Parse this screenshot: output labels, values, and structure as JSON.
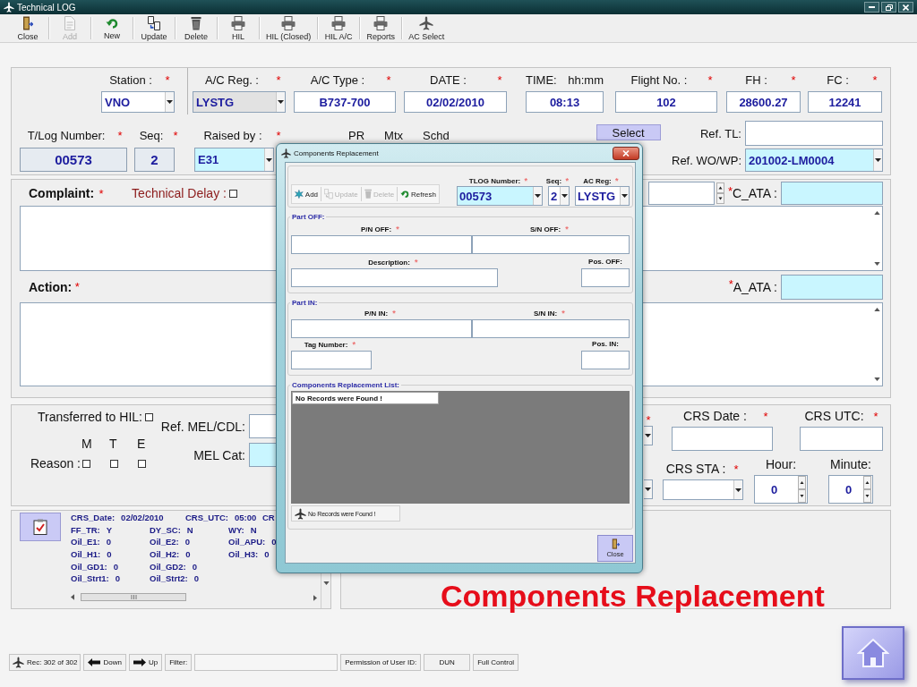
{
  "window": {
    "title": "Technical LOG"
  },
  "toolbar": [
    {
      "label": "Close",
      "kind": "door",
      "disabled": false
    },
    {
      "label": "Add",
      "kind": "add",
      "disabled": true
    },
    {
      "label": "New",
      "kind": "new",
      "disabled": false
    },
    {
      "label": "Update",
      "kind": "update",
      "disabled": false
    },
    {
      "label": "Delete",
      "kind": "delete",
      "disabled": false
    },
    {
      "label": "HIL",
      "kind": "print",
      "disabled": false
    },
    {
      "label": "HIL (Closed)",
      "kind": "print",
      "disabled": false
    },
    {
      "label": "HIL A/C",
      "kind": "print",
      "disabled": false
    },
    {
      "label": "Reports",
      "kind": "print",
      "disabled": false
    },
    {
      "label": "AC Select",
      "kind": "aircraft",
      "disabled": false
    }
  ],
  "flight": [
    {
      "label": "Station :",
      "asterisk": "*",
      "value": "VNO",
      "kind": "combo",
      "readonly": false
    },
    {
      "label": "A/C Reg. :",
      "asterisk": "*",
      "value": "LYSTG",
      "kind": "combo",
      "readonly": true
    },
    {
      "label": "A/C Type :",
      "asterisk": "*",
      "value": "B737-700",
      "kind": "text",
      "readonly": false
    },
    {
      "label": "DATE :",
      "asterisk": "*",
      "value": "02/02/2010",
      "kind": "text",
      "readonly": false
    },
    {
      "label": "TIME:",
      "format": "hh:mm",
      "value": "08:13",
      "kind": "text",
      "readonly": false
    },
    {
      "label": "Flight No. :",
      "asterisk": "*",
      "value": "102",
      "kind": "text",
      "readonly": false
    },
    {
      "label": "FH :",
      "asterisk": "*",
      "value": "28600.27",
      "kind": "text",
      "readonly": false
    },
    {
      "label": "FC :",
      "asterisk": "*",
      "value": "12241",
      "kind": "text",
      "readonly": false
    }
  ],
  "log": {
    "fields": [
      {
        "label": "T/Log Number:",
        "asterisk": "*",
        "value": "00573",
        "kind": "display",
        "highlighted": false
      },
      {
        "label": "Seq:",
        "asterisk": "*",
        "value": "2",
        "kind": "display",
        "highlighted": false
      },
      {
        "label": "Raised by :",
        "asterisk": "*",
        "value": "E31",
        "kind": "combo",
        "highlighted": true
      }
    ],
    "flags": [
      "PR",
      "Mtx",
      "Schd"
    ],
    "select_button": "Select",
    "refs": [
      {
        "label": "Ref. TL:",
        "kind": "text",
        "highlighted": false
      },
      {
        "label": "Ref. WO/WP:",
        "value": "201002-LM0004",
        "kind": "combo",
        "highlighted": true
      }
    ]
  },
  "complaint": {
    "label": "Complaint:",
    "asterisk": "*",
    "technical_delay": {
      "label": "Technical Delay :",
      "checked": false
    },
    "ata": {
      "asterisk": "*",
      "label": "C_ATA :",
      "highlighted": true
    }
  },
  "action": {
    "label": "Action:",
    "asterisk": "*",
    "ata": {
      "asterisk": "*",
      "label": "A_ATA :",
      "highlighted": true
    }
  },
  "release": {
    "transferred_to_hil": {
      "label": "Transferred to HIL:",
      "checked": false
    },
    "ref_mel_cdl": {
      "label": "Ref. MEL/CDL:",
      "highlighted": false
    },
    "reason": {
      "label": "Reason :",
      "options": [
        {
          "label": "M",
          "checked": false
        },
        {
          "label": "T",
          "checked": false
        },
        {
          "label": "E",
          "checked": false
        }
      ]
    },
    "mel_cat": {
      "label": "MEL Cat:",
      "highlighted": true
    },
    "crs_by": {
      "asterisk": "*"
    },
    "crs_date": {
      "label": "CRS Date :",
      "asterisk": "*"
    },
    "crs_utc": {
      "label": "CRS UTC:",
      "asterisk": "*"
    },
    "crs_sta": {
      "label": "CRS STA :",
      "asterisk": "*"
    },
    "hour": {
      "label": "Hour:",
      "value": "0"
    },
    "minute": {
      "label": "Minute:",
      "value": "0"
    }
  },
  "summary": [
    [
      {
        "key": "CRS_Date:",
        "value": "02/02/2010"
      },
      {
        "key": "CRS_UTC:",
        "value": "05:00"
      },
      {
        "key": "CR"
      }
    ],
    [
      {
        "key": "FF_TR:",
        "value": "Y"
      },
      {
        "key": "DY_SC:",
        "value": "N"
      },
      {
        "key": "WY:",
        "value": "N"
      }
    ],
    [
      {
        "key": "Oil_E1:",
        "value": "0"
      },
      {
        "key": "Oil_E2:",
        "value": "0"
      },
      {
        "key": "Oil_APU:",
        "value": "0"
      }
    ],
    [
      {
        "key": "Oil_H1:",
        "value": "0"
      },
      {
        "key": "Oil_H2:",
        "value": "0"
      },
      {
        "key": "Oil_H3:",
        "value": "0"
      }
    ],
    [
      {
        "key": "Oil_GD1:",
        "value": "0"
      },
      {
        "key": "Oil_GD2:",
        "value": "0"
      }
    ],
    [
      {
        "key": "Oil_Strt1:",
        "value": "0"
      },
      {
        "key": "Oil_Strt2:",
        "value": "0"
      }
    ]
  ],
  "dialog": {
    "title": "Components Replacement",
    "toolbar": [
      {
        "label": "Add",
        "kind": "insert",
        "disabled": false
      },
      {
        "label": "Update",
        "kind": "update",
        "disabled": true
      },
      {
        "label": "Delete",
        "kind": "delete",
        "disabled": true
      },
      {
        "label": "Refresh",
        "kind": "refresh",
        "disabled": false
      }
    ],
    "keys": [
      {
        "label": "TLOG Number:",
        "asterisk": "*",
        "value": "00573",
        "highlighted": true
      },
      {
        "label": "Seq:",
        "asterisk": "*",
        "value": "2",
        "highlighted": false
      },
      {
        "label": "AC Reg:",
        "asterisk": "*",
        "value": "LYSTG",
        "highlighted": false
      }
    ],
    "groups": [
      {
        "legend": "Part OFF:",
        "fields": [
          {
            "label": "P/N OFF:",
            "asterisk": "*"
          },
          {
            "label": "S/N OFF:",
            "asterisk": "*"
          },
          {
            "label": "Description:",
            "asterisk": "*"
          },
          {
            "label": "Pos. OFF:"
          }
        ]
      },
      {
        "legend": "Part IN:",
        "fields": [
          {
            "label": "P/N IN:",
            "asterisk": "*"
          },
          {
            "label": "S/N IN:",
            "asterisk": "*"
          },
          {
            "label": "Tag Number:",
            "asterisk": "*"
          },
          {
            "label": "Pos. IN:"
          }
        ]
      }
    ],
    "list": {
      "legend": "Components Replacement List:",
      "header": "No Records were Found !",
      "footer": "No Records were Found !"
    },
    "close_button": "Close"
  },
  "caption": "Components Replacement",
  "status_bar": {
    "record": "Rec: 302 of 302",
    "down": "Down",
    "up": "Up",
    "filter_label": "Filter:",
    "permission_label": "Permission of User ID:",
    "user_id": "DUN",
    "permission": "Full Control"
  }
}
